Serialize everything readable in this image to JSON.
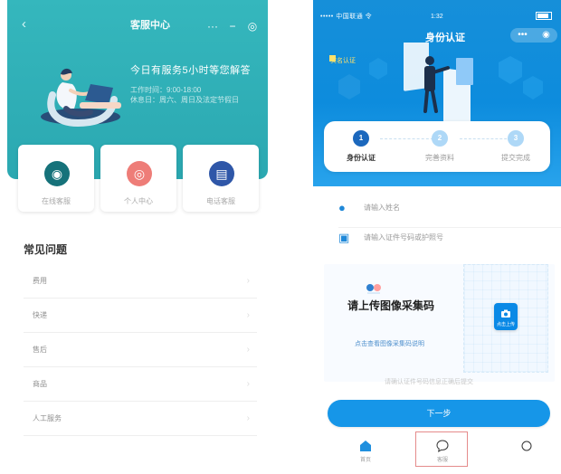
{
  "left_screen": {
    "title": "客服中心",
    "capsule": {
      "more": "···",
      "minimize": "−",
      "target": "◎"
    },
    "hero": {
      "headline": "今日有服务5小时等您解答",
      "subline_1": "工作时间：9:00-18:00",
      "subline_2": "休息日：周六、周日及法定节假日"
    },
    "services": [
      {
        "label": "在线客服",
        "icon": "chat-icon",
        "color": "#16727a"
      },
      {
        "label": "个人中心",
        "icon": "person-circle-icon",
        "color": "#ee7d78"
      },
      {
        "label": "电话客服",
        "icon": "document-icon",
        "color": "#2f57a8"
      }
    ],
    "faq": {
      "title": "常见问题",
      "items": [
        {
          "label": "费用",
          "arrow": "›"
        },
        {
          "label": "快递",
          "arrow": "›"
        },
        {
          "label": "售后",
          "arrow": "›"
        },
        {
          "label": "商品",
          "arrow": "›"
        },
        {
          "label": "人工服务",
          "arrow": "›"
        }
      ]
    }
  },
  "right_screen": {
    "status": {
      "left": "••••• 中国联通 令",
      "time": "1:32"
    },
    "title": "身份认证",
    "capsule": {
      "more": "•••",
      "target": "◉"
    },
    "badge": "实名认证",
    "steps": [
      {
        "number": "1",
        "label": "身份认证",
        "active": true
      },
      {
        "number": "2",
        "label": "完善资料",
        "active": false
      },
      {
        "number": "3",
        "label": "提交完成",
        "active": false
      }
    ],
    "fields": [
      {
        "icon": "person-icon",
        "placeholder": "请输入姓名"
      },
      {
        "icon": "id-card-icon",
        "placeholder": "请输入证件号码或护照号"
      }
    ],
    "upload": {
      "title": "请上传图像采集码",
      "link": "点击查看图像采集码说明",
      "camera_label": "点击上传"
    },
    "hint": "请确认证件号码信息正确后提交",
    "next_button": "下一步",
    "tabs": [
      {
        "label": "首页",
        "icon": "home-icon"
      },
      {
        "label": "客服",
        "icon": "chat-bubble-icon"
      },
      {
        "label": "",
        "icon": "circle-outline-icon"
      }
    ]
  },
  "colors": {
    "teal": "#32b2b9",
    "blue": "#0d8cdd",
    "accent_red": "#e58b8b"
  }
}
